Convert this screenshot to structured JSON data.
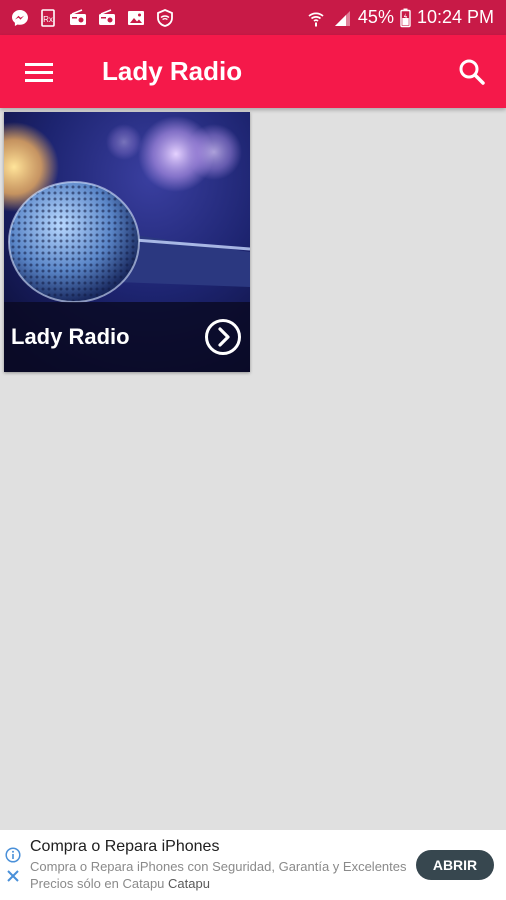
{
  "status_bar": {
    "battery": "45%",
    "time": "10:24 PM",
    "icons": [
      "messenger-icon",
      "rx-icon",
      "radio-icon",
      "radio-icon",
      "image-icon",
      "vpn-shield-icon",
      "wifi-icon",
      "signal-icon",
      "battery-icon"
    ]
  },
  "app_bar": {
    "title": "Lady Radio",
    "icons": [
      "menu-icon",
      "search-icon"
    ]
  },
  "cards": [
    {
      "title": "Lady Radio",
      "image": "microphone with bokeh lights",
      "action_icon": "chevron-right-circle-icon"
    }
  ],
  "ad": {
    "title": "Compra o Repara iPhones",
    "description": "Compra o Repara iPhones con Seguridad, Garantía y Excelentes Precios sólo en Catapu",
    "brand": "Catapu",
    "button_label": "ABRIR",
    "icons": [
      "info-icon",
      "close-icon"
    ]
  },
  "colors": {
    "status_bar": "#c81a47",
    "app_bar": "#f5194a",
    "background": "#e0e0e0",
    "ad_button": "#37474f",
    "ad_accent": "#4a90d9"
  }
}
